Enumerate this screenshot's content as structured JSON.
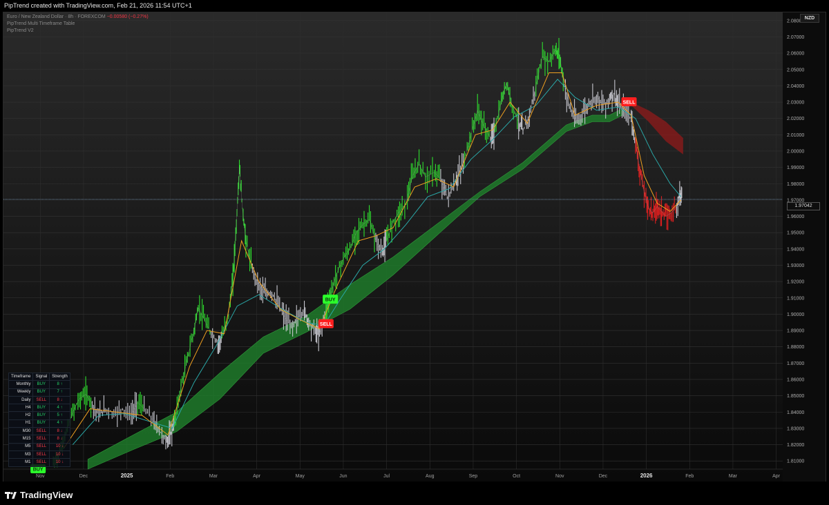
{
  "header": {
    "title": "PipTrend created with TradingView.com, Feb 21, 2026 11:54 UTC+1"
  },
  "legend": {
    "symbol": "Euro / New Zealand Dollar · 8h · FOREXCOM",
    "change": "−0.00580 (−0.27%)",
    "indicator1": "PipTrend Multi Timeframe Table",
    "indicator2": "PipTrend V2"
  },
  "currency_badge": "NZD",
  "current_price": "1.97042",
  "signals": {
    "buy_label": "BUY",
    "sell_label": "SELL"
  },
  "mtf_table": {
    "headers": [
      "Timeframe",
      "Signal",
      "Strength"
    ],
    "rows": [
      {
        "tf": "Monthly",
        "signal": "BUY",
        "strength": "8 ↑"
      },
      {
        "tf": "Weekly",
        "signal": "BUY",
        "strength": "7 ↑"
      },
      {
        "tf": "Daily",
        "signal": "SELL",
        "strength": "8 ↓"
      },
      {
        "tf": "H4",
        "signal": "BUY",
        "strength": "4 ↑"
      },
      {
        "tf": "H2",
        "signal": "BUY",
        "strength": "5 ↑"
      },
      {
        "tf": "H1",
        "signal": "BUY",
        "strength": "4 ↑"
      },
      {
        "tf": "M30",
        "signal": "SELL",
        "strength": "8 ↓"
      },
      {
        "tf": "M15",
        "signal": "SELL",
        "strength": "8 ↓"
      },
      {
        "tf": "M5",
        "signal": "SELL",
        "strength": "10 ↓"
      },
      {
        "tf": "M3",
        "signal": "SELL",
        "strength": "10 ↓"
      },
      {
        "tf": "M1",
        "signal": "SELL",
        "strength": "10 ↓"
      }
    ]
  },
  "footer": {
    "brand": "TradingView"
  },
  "colors": {
    "bull": "#2ee02e",
    "bear": "#e01f1f",
    "neutral": "#c8c8d0",
    "ema_fast": "#f0a020",
    "ema_slow": "#2aa8a8",
    "cloud_bull": "#1f7a2a",
    "cloud_bear": "#8a1a1a"
  },
  "chart_data": {
    "type": "line",
    "title": "Euro / New Zealand Dollar · 8h · FOREXCOM",
    "xlabel": "",
    "ylabel": "",
    "ylim": [
      1.805,
      2.085
    ],
    "y_ticks": [
      "2.08000",
      "2.07000",
      "2.06000",
      "2.05000",
      "2.04000",
      "2.03000",
      "2.02000",
      "2.01000",
      "2.00000",
      "1.99000",
      "1.98000",
      "1.97000",
      "1.96000",
      "1.95000",
      "1.94000",
      "1.93000",
      "1.92000",
      "1.91000",
      "1.90000",
      "1.89000",
      "1.88000",
      "1.87000",
      "1.86000",
      "1.85000",
      "1.84000",
      "1.83000",
      "1.82000",
      "1.81000"
    ],
    "x_ticks": [
      {
        "label": "Nov",
        "bold": false
      },
      {
        "label": "Dec",
        "bold": false
      },
      {
        "label": "2025",
        "bold": true
      },
      {
        "label": "Feb",
        "bold": false
      },
      {
        "label": "Mar",
        "bold": false
      },
      {
        "label": "Apr",
        "bold": false
      },
      {
        "label": "May",
        "bold": false
      },
      {
        "label": "Jun",
        "bold": false
      },
      {
        "label": "Jul",
        "bold": false
      },
      {
        "label": "Aug",
        "bold": false
      },
      {
        "label": "Sep",
        "bold": false
      },
      {
        "label": "Oct",
        "bold": false
      },
      {
        "label": "Nov",
        "bold": false
      },
      {
        "label": "Dec",
        "bold": false
      },
      {
        "label": "2026",
        "bold": true
      },
      {
        "label": "Feb",
        "bold": false
      },
      {
        "label": "Mar",
        "bold": false
      },
      {
        "label": "Apr",
        "bold": false
      }
    ],
    "x_range_months": [
      0,
      18
    ],
    "series": [
      {
        "name": "EUR/NZD",
        "role": "price",
        "points": [
          [
            1.15,
            1.808,
            "bull"
          ],
          [
            1.3,
            1.815,
            "bull"
          ],
          [
            1.45,
            1.828,
            "bull"
          ],
          [
            1.6,
            1.84,
            "bull"
          ],
          [
            1.75,
            1.848,
            "bull"
          ],
          [
            1.9,
            1.851,
            "bull"
          ],
          [
            2.05,
            1.845,
            "neutral"
          ],
          [
            2.2,
            1.838,
            "neutral"
          ],
          [
            2.35,
            1.842,
            "neutral"
          ],
          [
            2.55,
            1.839,
            "neutral"
          ],
          [
            2.75,
            1.842,
            "neutral"
          ],
          [
            2.95,
            1.838,
            "neutral"
          ],
          [
            3.1,
            1.846,
            "bull"
          ],
          [
            3.25,
            1.842,
            "neutral"
          ],
          [
            3.45,
            1.835,
            "neutral"
          ],
          [
            3.6,
            1.829,
            "neutral"
          ],
          [
            3.75,
            1.822,
            "neutral"
          ],
          [
            3.85,
            1.825,
            "neutral"
          ],
          [
            3.95,
            1.834,
            "bull"
          ],
          [
            4.1,
            1.855,
            "bull"
          ],
          [
            4.25,
            1.873,
            "bull"
          ],
          [
            4.4,
            1.89,
            "bull"
          ],
          [
            4.5,
            1.904,
            "bull"
          ],
          [
            4.65,
            1.896,
            "bull"
          ],
          [
            4.8,
            1.888,
            "neutral"
          ],
          [
            4.95,
            1.882,
            "neutral"
          ],
          [
            5.05,
            1.886,
            "bull"
          ],
          [
            5.2,
            1.9,
            "bull"
          ],
          [
            5.3,
            1.922,
            "bull"
          ],
          [
            5.38,
            1.955,
            "bull"
          ],
          [
            5.45,
            1.99,
            "bull"
          ],
          [
            5.52,
            1.965,
            "bull"
          ],
          [
            5.6,
            1.945,
            "bull"
          ],
          [
            5.75,
            1.927,
            "neutral"
          ],
          [
            5.9,
            1.918,
            "neutral"
          ],
          [
            6.05,
            1.912,
            "neutral"
          ],
          [
            6.2,
            1.913,
            "neutral"
          ],
          [
            6.35,
            1.906,
            "neutral"
          ],
          [
            6.5,
            1.898,
            "neutral"
          ],
          [
            6.65,
            1.892,
            "neutral"
          ],
          [
            6.8,
            1.898,
            "neutral"
          ],
          [
            6.95,
            1.902,
            "neutral"
          ],
          [
            7.05,
            1.895,
            "neutral"
          ],
          [
            7.2,
            1.89,
            "neutral"
          ],
          [
            7.3,
            1.888,
            "neutral"
          ],
          [
            7.45,
            1.903,
            "bull"
          ],
          [
            7.55,
            1.912,
            "bull"
          ],
          [
            7.7,
            1.925,
            "bull"
          ],
          [
            7.85,
            1.934,
            "bull"
          ],
          [
            8.0,
            1.94,
            "bull"
          ],
          [
            8.15,
            1.95,
            "bull"
          ],
          [
            8.3,
            1.955,
            "bull"
          ],
          [
            8.45,
            1.958,
            "bull"
          ],
          [
            8.6,
            1.945,
            "neutral"
          ],
          [
            8.75,
            1.938,
            "neutral"
          ],
          [
            8.85,
            1.945,
            "bull"
          ],
          [
            9.0,
            1.957,
            "bull"
          ],
          [
            9.15,
            1.963,
            "bull"
          ],
          [
            9.3,
            1.968,
            "bull"
          ],
          [
            9.45,
            1.985,
            "bull"
          ],
          [
            9.6,
            1.992,
            "bull"
          ],
          [
            9.75,
            1.984,
            "bull"
          ],
          [
            9.95,
            1.987,
            "bull"
          ],
          [
            10.1,
            1.983,
            "neutral"
          ],
          [
            10.25,
            1.972,
            "neutral"
          ],
          [
            10.4,
            1.978,
            "neutral"
          ],
          [
            10.5,
            1.985,
            "neutral"
          ],
          [
            10.65,
            1.995,
            "bull"
          ],
          [
            10.8,
            2.01,
            "bull"
          ],
          [
            10.95,
            2.025,
            "bull"
          ],
          [
            11.1,
            2.015,
            "bull"
          ],
          [
            11.25,
            2.008,
            "neutral"
          ],
          [
            11.35,
            2.013,
            "bull"
          ],
          [
            11.5,
            2.03,
            "bull"
          ],
          [
            11.62,
            2.042,
            "bull"
          ],
          [
            11.75,
            2.028,
            "bull"
          ],
          [
            11.9,
            2.018,
            "neutral"
          ],
          [
            12.0,
            2.012,
            "neutral"
          ],
          [
            12.15,
            2.022,
            "neutral"
          ],
          [
            12.3,
            2.04,
            "bull"
          ],
          [
            12.45,
            2.058,
            "bull"
          ],
          [
            12.6,
            2.055,
            "bull"
          ],
          [
            12.75,
            2.062,
            "bull"
          ],
          [
            12.85,
            2.058,
            "bull"
          ],
          [
            12.95,
            2.04,
            "neutral"
          ],
          [
            13.1,
            2.025,
            "neutral"
          ],
          [
            13.25,
            2.018,
            "neutral"
          ],
          [
            13.4,
            2.024,
            "neutral"
          ],
          [
            13.55,
            2.03,
            "neutral"
          ],
          [
            13.7,
            2.034,
            "neutral"
          ],
          [
            13.85,
            2.028,
            "neutral"
          ],
          [
            14.0,
            2.032,
            "neutral"
          ],
          [
            14.1,
            2.035,
            "neutral"
          ],
          [
            14.2,
            2.028,
            "neutral"
          ],
          [
            14.35,
            2.025,
            "neutral"
          ],
          [
            14.5,
            2.02,
            "neutral"
          ],
          [
            14.6,
            2.005,
            "bear"
          ],
          [
            14.7,
            1.988,
            "bear"
          ],
          [
            14.8,
            1.975,
            "bear"
          ],
          [
            14.9,
            1.965,
            "bear"
          ],
          [
            15.0,
            1.962,
            "bear"
          ],
          [
            15.1,
            1.966,
            "bear"
          ],
          [
            15.2,
            1.963,
            "bear"
          ],
          [
            15.3,
            1.96,
            "bear"
          ],
          [
            15.42,
            1.962,
            "bear"
          ],
          [
            15.55,
            1.966,
            "neutral"
          ],
          [
            15.62,
            1.975,
            "neutral"
          ],
          [
            15.68,
            1.972,
            "neutral"
          ]
        ]
      },
      {
        "name": "Fast EMA",
        "role": "ema_fast",
        "points": [
          [
            1.4,
            1.818
          ],
          [
            2.0,
            1.842
          ],
          [
            2.6,
            1.84
          ],
          [
            3.2,
            1.838
          ],
          [
            3.8,
            1.826
          ],
          [
            4.3,
            1.868
          ],
          [
            4.7,
            1.89
          ],
          [
            5.1,
            1.888
          ],
          [
            5.5,
            1.945
          ],
          [
            5.9,
            1.92
          ],
          [
            6.4,
            1.903
          ],
          [
            6.9,
            1.896
          ],
          [
            7.3,
            1.891
          ],
          [
            7.7,
            1.917
          ],
          [
            8.2,
            1.945
          ],
          [
            8.6,
            1.948
          ],
          [
            9.0,
            1.953
          ],
          [
            9.5,
            1.978
          ],
          [
            10.0,
            1.983
          ],
          [
            10.4,
            1.978
          ],
          [
            10.9,
            2.01
          ],
          [
            11.3,
            2.013
          ],
          [
            11.7,
            2.03
          ],
          [
            12.1,
            2.017
          ],
          [
            12.6,
            2.048
          ],
          [
            12.9,
            2.048
          ],
          [
            13.2,
            2.022
          ],
          [
            13.7,
            2.028
          ],
          [
            14.2,
            2.03
          ],
          [
            14.5,
            2.022
          ],
          [
            14.8,
            1.985
          ],
          [
            15.1,
            1.968
          ],
          [
            15.4,
            1.963
          ],
          [
            15.65,
            1.97
          ]
        ]
      },
      {
        "name": "Slow EMA",
        "role": "ema_slow",
        "points": [
          [
            1.6,
            1.82
          ],
          [
            2.2,
            1.838
          ],
          [
            2.8,
            1.839
          ],
          [
            3.4,
            1.834
          ],
          [
            3.9,
            1.83
          ],
          [
            4.4,
            1.858
          ],
          [
            4.9,
            1.88
          ],
          [
            5.4,
            1.905
          ],
          [
            5.9,
            1.912
          ],
          [
            6.5,
            1.902
          ],
          [
            7.0,
            1.895
          ],
          [
            7.4,
            1.893
          ],
          [
            7.8,
            1.91
          ],
          [
            8.3,
            1.93
          ],
          [
            8.8,
            1.94
          ],
          [
            9.3,
            1.955
          ],
          [
            9.8,
            1.972
          ],
          [
            10.3,
            1.977
          ],
          [
            10.8,
            1.995
          ],
          [
            11.3,
            2.007
          ],
          [
            11.8,
            2.021
          ],
          [
            12.3,
            2.028
          ],
          [
            12.8,
            2.044
          ],
          [
            13.2,
            2.033
          ],
          [
            13.7,
            2.025
          ],
          [
            14.2,
            2.027
          ],
          [
            14.6,
            2.02
          ],
          [
            15.0,
            1.998
          ],
          [
            15.4,
            1.98
          ],
          [
            15.65,
            1.972
          ]
        ]
      },
      {
        "name": "Cloud Upper",
        "role": "cloud_upper",
        "points": [
          [
            1.95,
            1.811
          ],
          [
            3.0,
            1.826
          ],
          [
            4.0,
            1.84
          ],
          [
            5.0,
            1.864
          ],
          [
            6.0,
            1.886
          ],
          [
            7.0,
            1.899
          ],
          [
            8.0,
            1.918
          ],
          [
            9.0,
            1.935
          ],
          [
            10.0,
            1.955
          ],
          [
            11.0,
            1.975
          ],
          [
            12.0,
            1.993
          ],
          [
            13.0,
            2.016
          ],
          [
            13.6,
            2.022
          ],
          [
            14.0,
            2.022
          ],
          [
            14.3,
            2.026
          ]
        ]
      },
      {
        "name": "Cloud Lower",
        "role": "cloud_lower",
        "points": [
          [
            1.95,
            1.805
          ],
          [
            3.0,
            1.817
          ],
          [
            4.0,
            1.828
          ],
          [
            5.0,
            1.848
          ],
          [
            6.0,
            1.876
          ],
          [
            7.0,
            1.889
          ],
          [
            8.0,
            1.903
          ],
          [
            9.0,
            1.924
          ],
          [
            10.0,
            1.948
          ],
          [
            11.0,
            1.972
          ],
          [
            12.0,
            1.989
          ],
          [
            13.0,
            2.012
          ],
          [
            13.6,
            2.018
          ],
          [
            14.0,
            2.018
          ],
          [
            14.3,
            2.022
          ]
        ]
      },
      {
        "name": "Bear Cloud Upper",
        "role": "bear_upper",
        "points": [
          [
            14.5,
            2.03
          ],
          [
            14.9,
            2.025
          ],
          [
            15.3,
            2.018
          ],
          [
            15.7,
            2.008
          ]
        ]
      },
      {
        "name": "Bear Cloud Lower",
        "role": "bear_lower",
        "points": [
          [
            14.5,
            2.028
          ],
          [
            14.9,
            2.018
          ],
          [
            15.3,
            2.006
          ],
          [
            15.7,
            1.998
          ]
        ]
      }
    ],
    "markers": [
      {
        "type": "buy",
        "x": 7.55,
        "y": 1.909,
        "label": "BUY"
      },
      {
        "type": "sell",
        "x": 7.45,
        "y": 1.894,
        "label": "SELL"
      },
      {
        "type": "sell",
        "x": 14.45,
        "y": 2.03,
        "label": "SELL"
      },
      {
        "type": "buy",
        "x": 0.8,
        "y": 1.805,
        "label": "BUY"
      }
    ],
    "current_price_line": 1.9704
  }
}
